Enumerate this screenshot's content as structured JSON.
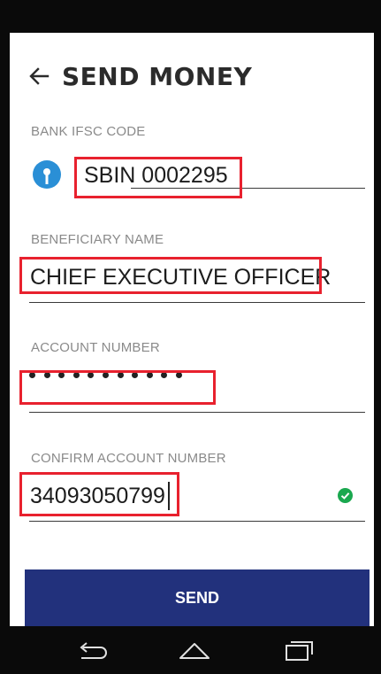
{
  "header": {
    "title": "SEND MONEY",
    "back_icon": "back-arrow-icon"
  },
  "form": {
    "ifsc": {
      "label": "BANK IFSC CODE",
      "value": "SBIN 0002295",
      "bank_icon": "sbi-logo-icon"
    },
    "beneficiary": {
      "label": "BENEFICIARY NAME",
      "value": "CHIEF EXECUTIVE OFFICER"
    },
    "account": {
      "label": "ACCOUNT NUMBER",
      "masked_length": 11
    },
    "confirm": {
      "label": "CONFIRM ACCOUNT NUMBER",
      "value": "34093050799",
      "status_icon": "check-circle-icon"
    }
  },
  "actions": {
    "send_label": "SEND"
  },
  "colors": {
    "highlight": "#e8212e",
    "button": "#22317c",
    "success": "#1aa84f",
    "sbi_blue": "#2a8fd6"
  },
  "nav": {
    "back": "nav-back-icon",
    "home": "nav-home-icon",
    "recents": "nav-recents-icon"
  }
}
